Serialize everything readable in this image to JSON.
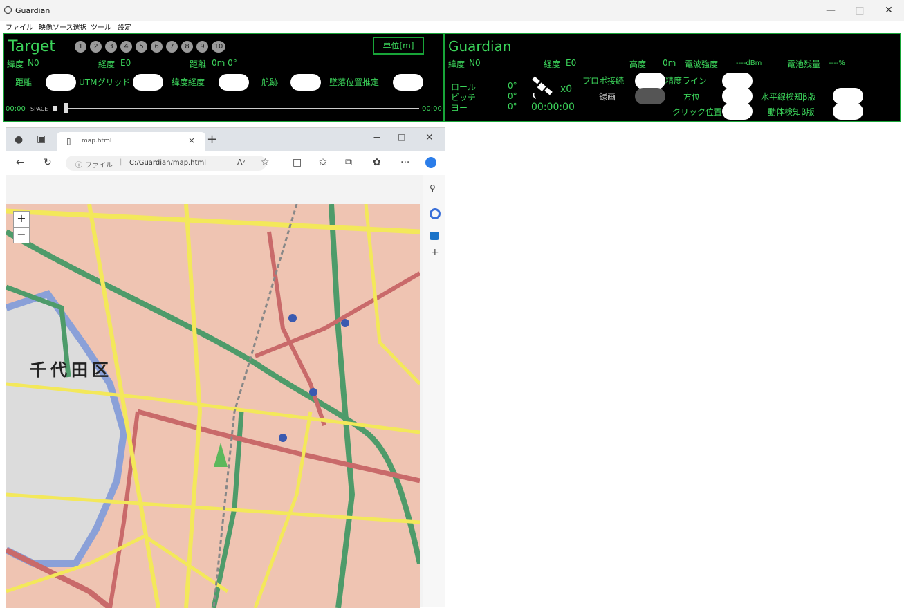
{
  "app": {
    "title": "Guardian",
    "menu": [
      "ファイル",
      "映像ソース選択",
      "ツール",
      "設定"
    ],
    "window_controls": {
      "minimize": "—",
      "maximize": "□",
      "close": "✕"
    }
  },
  "target_panel": {
    "title": "Target",
    "numbered_buttons": [
      "1",
      "2",
      "3",
      "4",
      "5",
      "6",
      "7",
      "8",
      "9",
      "10"
    ],
    "unit_button": "単位[m]",
    "lat_label": "緯度",
    "lat_value": "N0",
    "lon_label": "経度",
    "lon_value": "E0",
    "distance_label": "距離",
    "distance_value": "0m 0°",
    "toggles": [
      "距離",
      "UTMグリッド",
      "緯度経度",
      "航跡",
      "墜落位置推定"
    ],
    "time_start": "00:00",
    "space_label": "SPACE",
    "time_end": "00:00"
  },
  "guardian_panel": {
    "title": "Guardian",
    "lat_label": "緯度",
    "lat_value": "N0",
    "lon_label": "経度",
    "lon_value": "E0",
    "alt_label": "高度",
    "alt_value": "0m",
    "signal_label": "電波強度",
    "signal_value": "----dBm",
    "battery_label": "電池残量",
    "battery_value": "----%",
    "roll_label": "ロール",
    "pitch_label": "ピッチ",
    "yaw_label": "ヨー",
    "roll_value": "0°",
    "pitch_value": "0°",
    "yaw_value": "0°",
    "satellite_count": "x0",
    "elapsed": "00:00:00",
    "propo_label": "プロポ接続",
    "record_label": "録画",
    "accuracy_line_label": "精度ライン",
    "bearing_label": "方位",
    "click_pos_label": "クリック位置",
    "horizon_label": "水平線検知β版",
    "motion_label": "動体検知β版"
  },
  "browser": {
    "tab_title": "map.html",
    "url_prefix": "ファイル",
    "url": "C:/Guardian/map.html",
    "map_district_label": "千代田区",
    "zoom_in": "+",
    "zoom_out": "−"
  }
}
